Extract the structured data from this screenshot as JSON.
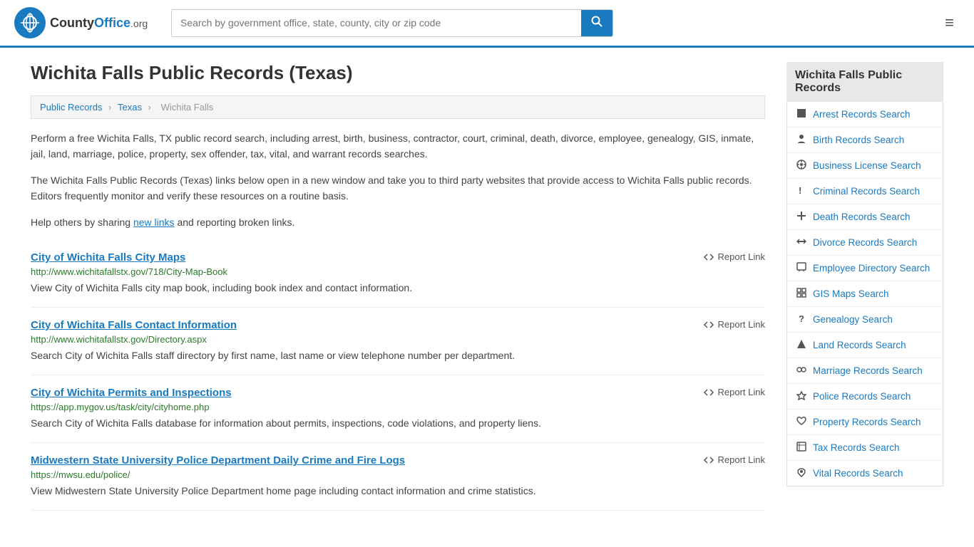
{
  "header": {
    "logo_symbol": "CO",
    "logo_name": "CountyOffice",
    "logo_ext": ".org",
    "search_placeholder": "Search by government office, state, county, city or zip code",
    "menu_icon": "≡"
  },
  "page": {
    "title": "Wichita Falls Public Records (Texas)",
    "breadcrumbs": [
      "Public Records",
      "Texas",
      "Wichita Falls"
    ],
    "description1": "Perform a free Wichita Falls, TX public record search, including arrest, birth, business, contractor, court, criminal, death, divorce, employee, genealogy, GIS, inmate, jail, land, marriage, police, property, sex offender, tax, vital, and warrant records searches.",
    "description2": "The Wichita Falls Public Records (Texas) links below open in a new window and take you to third party websites that provide access to Wichita Falls public records. Editors frequently monitor and verify these resources on a routine basis.",
    "description3_prefix": "Help others by sharing ",
    "description3_link": "new links",
    "description3_suffix": " and reporting broken links."
  },
  "results": [
    {
      "title": "City of Wichita Falls City Maps",
      "url": "http://www.wichitafallstx.gov/718/City-Map-Book",
      "description": "View City of Wichita Falls city map book, including book index and contact information.",
      "report_label": "Report Link"
    },
    {
      "title": "City of Wichita Falls Contact Information",
      "url": "http://www.wichitafallstx.gov/Directory.aspx",
      "description": "Search City of Wichita Falls staff directory by first name, last name or view telephone number per department.",
      "report_label": "Report Link"
    },
    {
      "title": "City of Wichita Permits and Inspections",
      "url": "https://app.mygov.us/task/city/cityhome.php",
      "description": "Search City of Wichita Falls database for information about permits, inspections, code violations, and property liens.",
      "report_label": "Report Link"
    },
    {
      "title": "Midwestern State University Police Department Daily Crime and Fire Logs",
      "url": "https://mwsu.edu/police/",
      "description": "View Midwestern State University Police Department home page including contact information and crime statistics.",
      "report_label": "Report Link"
    }
  ],
  "sidebar": {
    "title": "Wichita Falls Public Records",
    "items": [
      {
        "label": "Arrest Records Search",
        "icon": "■"
      },
      {
        "label": "Birth Records Search",
        "icon": "🕴"
      },
      {
        "label": "Business License Search",
        "icon": "⚙"
      },
      {
        "label": "Criminal Records Search",
        "icon": "❕"
      },
      {
        "label": "Death Records Search",
        "icon": "✚"
      },
      {
        "label": "Divorce Records Search",
        "icon": "↔"
      },
      {
        "label": "Employee Directory Search",
        "icon": "▣"
      },
      {
        "label": "GIS Maps Search",
        "icon": "⊞"
      },
      {
        "label": "Genealogy Search",
        "icon": "?"
      },
      {
        "label": "Land Records Search",
        "icon": "▲"
      },
      {
        "label": "Marriage Records Search",
        "icon": "∞"
      },
      {
        "label": "Police Records Search",
        "icon": "◈"
      },
      {
        "label": "Property Records Search",
        "icon": "⌂"
      },
      {
        "label": "Tax Records Search",
        "icon": "⊡"
      },
      {
        "label": "Vital Records Search",
        "icon": "♥"
      }
    ]
  }
}
